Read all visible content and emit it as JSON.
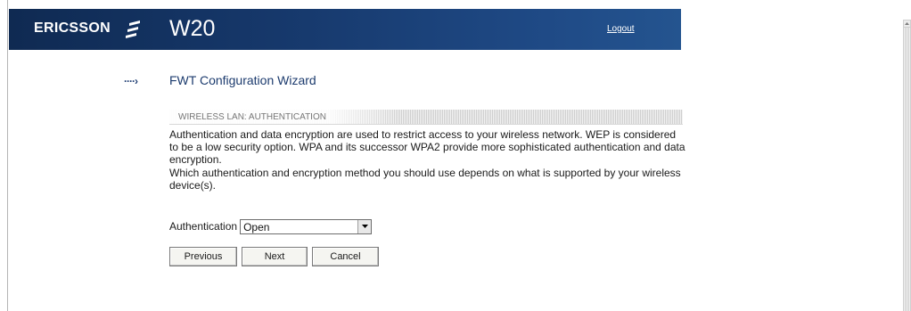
{
  "header": {
    "brand": "ERICSSON",
    "brand_mark_icon": "ericsson-logo-icon",
    "product": "W20",
    "logout_label": "Logout",
    "colors": {
      "bar_dark": "#0f2a52",
      "bar_light": "#24548f"
    }
  },
  "wizard": {
    "arrow_icon": "dotted-arrow-icon",
    "arrow_glyph": "····›",
    "title": "FWT Configuration Wizard"
  },
  "section": {
    "title": "WIRELESS LAN: AUTHENTICATION",
    "paragraph1": "Authentication and data encryption are used to restrict access to your wireless network. WEP is considered to be a low security option. WPA and its successor WPA2 provide more sophisticated authentication and data encryption.",
    "paragraph2": "Which authentication and encryption method you should use depends on what is supported by your wireless device(s)."
  },
  "form": {
    "auth_label": "Authentication",
    "auth_value": "Open",
    "dropdown_icon": "chevron-down-icon"
  },
  "buttons": {
    "previous": "Previous",
    "next": "Next",
    "cancel": "Cancel"
  },
  "scrollbar": {
    "up_icon": "scroll-up-arrow-icon"
  }
}
